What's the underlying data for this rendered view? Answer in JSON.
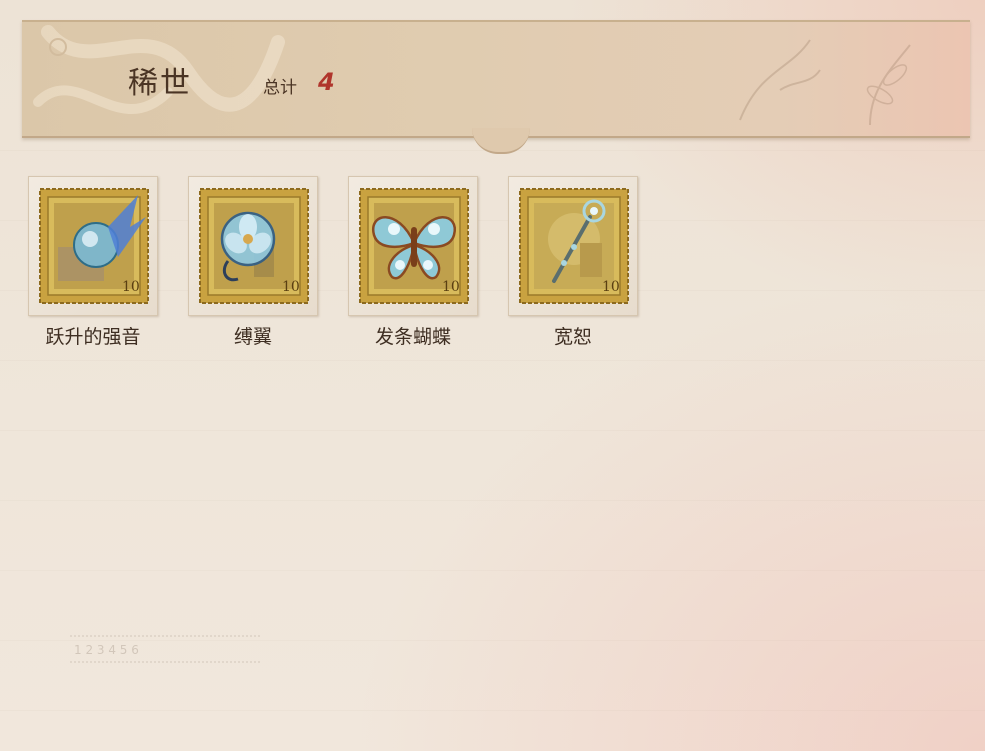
{
  "header": {
    "title": "稀世",
    "total_label": "总计",
    "total_value": "4"
  },
  "items": [
    {
      "name": "跃升的强音",
      "icon": "puzzle-orb-icon",
      "value": "10"
    },
    {
      "name": "缚翼",
      "icon": "glass-flower-icon",
      "value": "10"
    },
    {
      "name": "发条蝴蝶",
      "icon": "clockwork-butterfly-icon",
      "value": "10"
    },
    {
      "name": "宽恕",
      "icon": "staff-icon",
      "value": "10"
    }
  ],
  "colors": {
    "accent": "#b0352c",
    "text": "#4a3424",
    "stamp_gold": "#c9a240"
  }
}
